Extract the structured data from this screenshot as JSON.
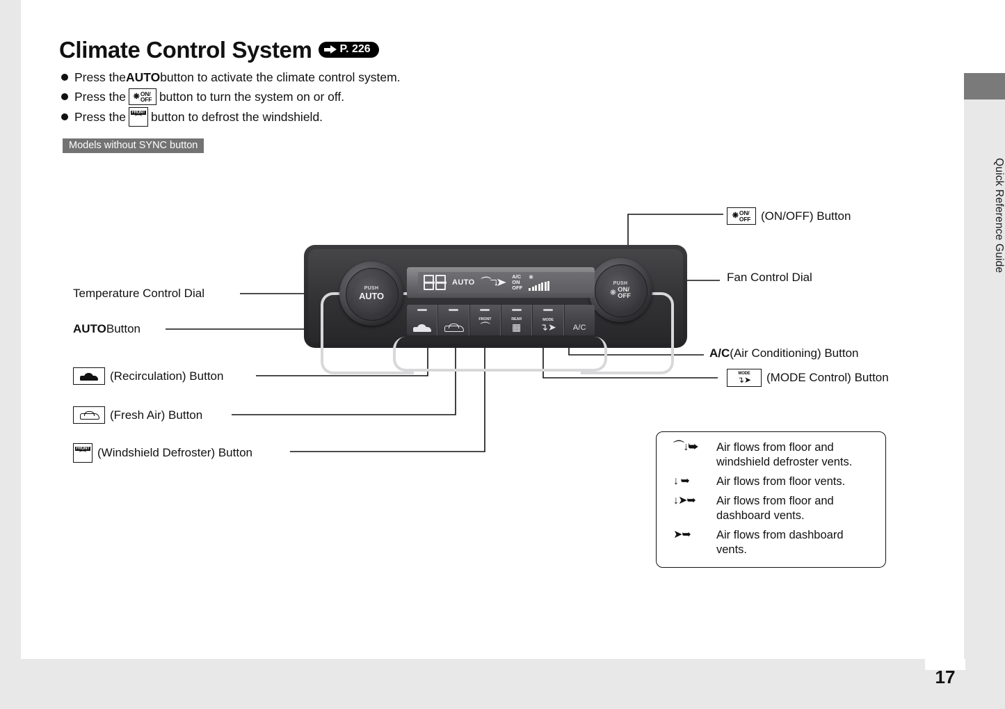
{
  "page": {
    "number": "17",
    "side_tab_label": "Quick Reference Guide"
  },
  "header": {
    "title": "Climate Control System",
    "reference_page": "P. 226"
  },
  "instructions": [
    {
      "id": "auto",
      "before": "Press the ",
      "emphasis": "AUTO",
      "after": " button to activate the climate control system.",
      "icon": null
    },
    {
      "id": "onoff",
      "before": "Press the ",
      "emphasis": null,
      "after": " button to turn the system on or off.",
      "icon": "fan-onoff-icon"
    },
    {
      "id": "defrost",
      "before": "Press the ",
      "emphasis": null,
      "after": " button to defrost the windshield.",
      "icon": "front-defroster-icon"
    }
  ],
  "models_badge": "Models without SYNC button",
  "panel": {
    "display": {
      "temperature": "88",
      "auto_label": "AUTO",
      "mode_icons": "defrost-floor-airflow-icon",
      "ac_label_line1": "A/C",
      "ac_label_line2": "ON",
      "ac_label_line3": "OFF",
      "fan_icon": "fan-icon",
      "fan_bars": 7
    },
    "left_dial": {
      "push_label": "PUSH",
      "main_label": "AUTO"
    },
    "right_dial": {
      "push_label": "PUSH",
      "line1": "ON/",
      "line2": "OFF",
      "icon": "fan-icon"
    },
    "buttons": [
      {
        "name": "recirculation-button",
        "label": "",
        "icon": "car-recirculation-icon"
      },
      {
        "name": "fresh-air-button",
        "label": "",
        "icon": "car-fresh-air-icon"
      },
      {
        "name": "front-defroster-button",
        "label": "FRONT",
        "icon": "windshield-defroster-icon"
      },
      {
        "name": "rear-defroster-button",
        "label": "REAR",
        "icon": "rear-defroster-icon"
      },
      {
        "name": "mode-button",
        "label": "MODE",
        "icon": "mode-airflow-icon"
      },
      {
        "name": "ac-button",
        "label": "A/C",
        "icon": null
      }
    ]
  },
  "callouts": {
    "temperature_control_dial": "Temperature Control Dial",
    "auto_button_emphasis": "AUTO",
    "auto_button_rest": " Button",
    "recirculation": "(Recirculation) Button",
    "fresh_air": "(Fresh Air) Button",
    "windshield_defroster": "(Windshield Defroster) Button",
    "on_off_button": "(ON/OFF) Button",
    "fan_control_dial": "Fan Control Dial",
    "ac_emphasis": "A/C",
    "ac_rest": " (Air Conditioning) Button",
    "mode_control": "(MODE Control) Button"
  },
  "legend": [
    {
      "icon": "defrost-floor-airflow-icon",
      "text": "Air flows from floor and windshield defroster vents."
    },
    {
      "icon": "floor-airflow-icon",
      "text": "Air flows from floor vents."
    },
    {
      "icon": "floor-dash-airflow-icon",
      "text": "Air flows from floor and dashboard vents."
    },
    {
      "icon": "dash-airflow-icon",
      "text": "Air flows from dashboard vents."
    }
  ],
  "colors": {
    "badge_gray": "#737373",
    "side_tab_gray": "#e8e8e9",
    "side_tab_dark": "#7a7a7a",
    "panel_dark": "#2e2e30",
    "chrome": "#d8d8da"
  }
}
